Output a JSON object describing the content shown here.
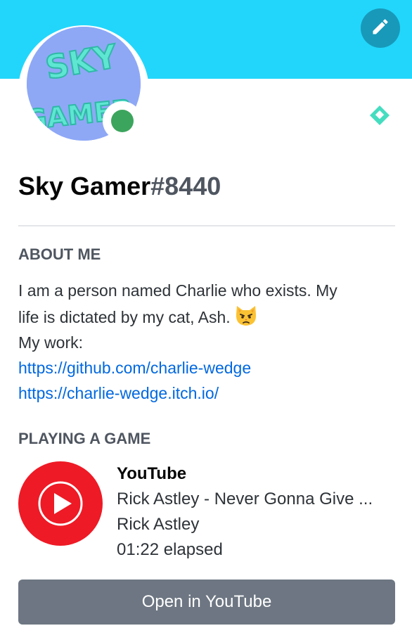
{
  "colors": {
    "banner": "#22d6fb",
    "edit_button": "#1899ba",
    "status_online": "#3ba55d",
    "link": "#0068e0",
    "heading": "#4f5660",
    "button": "#6d7682",
    "youtube_red": "#ee1a25"
  },
  "profile": {
    "avatar_text_top": "SKY",
    "avatar_text_bottom": "GAMER",
    "status": "online",
    "badge_icon": "hypesquad-balance-icon",
    "edit_icon": "pencil-icon",
    "username": "Sky Gamer",
    "discriminator": "#8440"
  },
  "about": {
    "heading": "ABOUT ME",
    "line1": "I am a person named Charlie who exists. My",
    "line2": "life is dictated by my cat, Ash.",
    "emoji": "pouting-cat-emoji",
    "line3": "My work:",
    "link1": "https://github.com/charlie-wedge",
    "link2": "https://charlie-wedge.itch.io/"
  },
  "activity": {
    "heading": "PLAYING A GAME",
    "icon": "youtube-music-icon",
    "name": "YouTube",
    "details": "Rick Astley - Never Gonna Give ...",
    "state": "Rick Astley",
    "elapsed": "01:22 elapsed",
    "button_label": "Open in YouTube"
  }
}
